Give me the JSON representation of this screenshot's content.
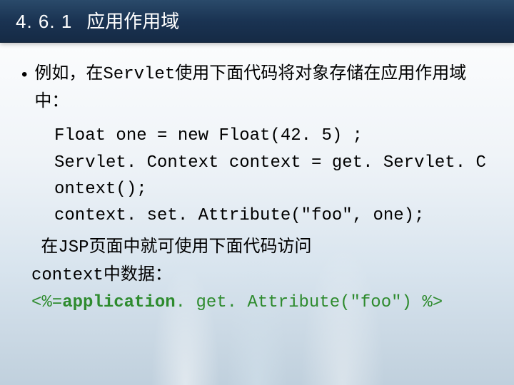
{
  "title": {
    "number": "4. 6. 1",
    "text": "应用作用域"
  },
  "bullet": "•",
  "intro": {
    "prefix": "例如，在",
    "code": "Servlet",
    "suffix": "使用下面代码将对象存储在应用作用域中："
  },
  "code": {
    "line1": "Float one = new Float(42. 5) ;",
    "line2": "Servlet. Context context = get. Servlet. Context();",
    "line3": "context. set. Attribute(\"foo\", one);"
  },
  "second": {
    "text_prefix": "在",
    "code1": "JSP",
    "text_mid": "页面中就可使用下面代码访问",
    "code2": "context",
    "text_suffix": "中数据：",
    "expr_open": "<%=",
    "expr_app": "application",
    "expr_rest": ". get. Attribute(\"foo\") %>"
  }
}
